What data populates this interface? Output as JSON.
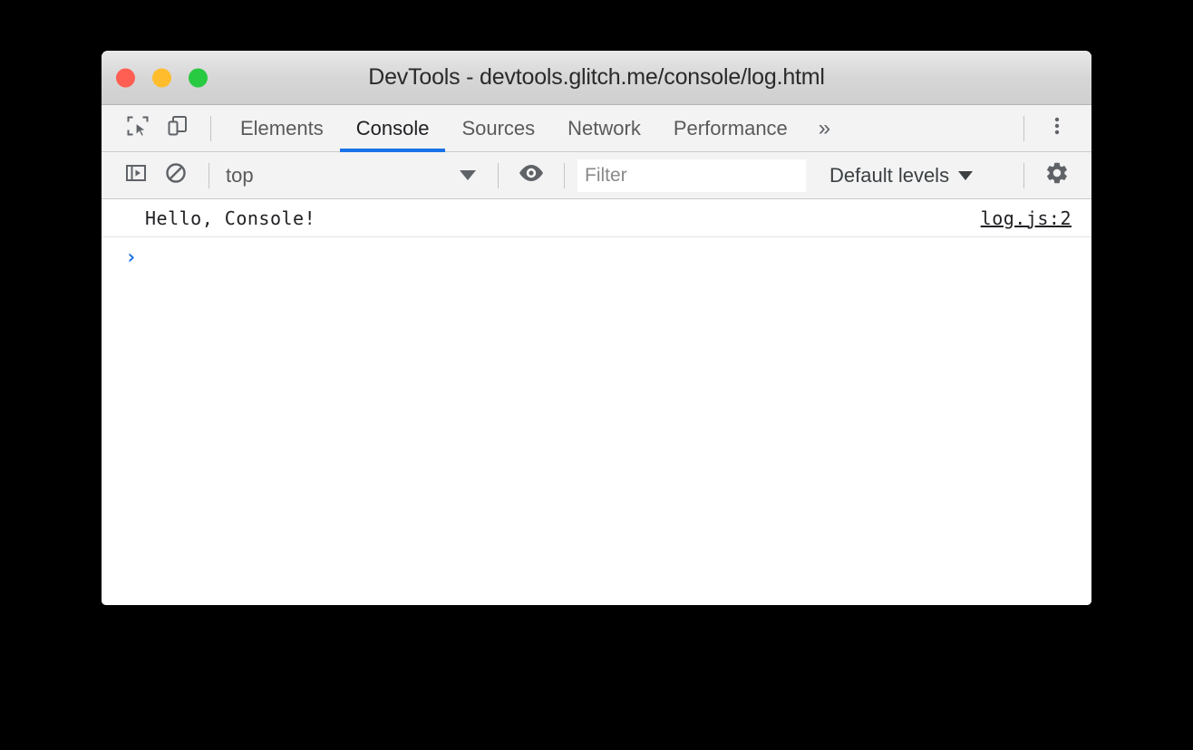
{
  "window": {
    "title": "DevTools - devtools.glitch.me/console/log.html",
    "traffic_lights": [
      {
        "name": "close",
        "color": "#ff5f52"
      },
      {
        "name": "minimize",
        "color": "#ffbd2e"
      },
      {
        "name": "zoom",
        "color": "#28ca42"
      }
    ]
  },
  "tab_bar": {
    "inspect_icon": "inspect-element-icon",
    "device_toolbar_icon": "device-toolbar-icon",
    "tabs": [
      {
        "label": "Elements",
        "active": false
      },
      {
        "label": "Console",
        "active": true
      },
      {
        "label": "Sources",
        "active": false
      },
      {
        "label": "Network",
        "active": false
      },
      {
        "label": "Performance",
        "active": false
      }
    ],
    "more_tabs_label": "»",
    "main_menu_icon": "kebab-menu-icon",
    "active_tab_color": "#1a73e8"
  },
  "console_toolbar": {
    "sidebar_toggle_icon": "show-console-sidebar-icon",
    "clear_console_icon": "clear-console-icon",
    "context": {
      "selected": "top",
      "caret": "chevron-down-icon"
    },
    "live_expression_icon": "eye-icon",
    "filter": {
      "placeholder": "Filter",
      "value": ""
    },
    "levels": {
      "selected": "Default levels",
      "caret": "chevron-down-icon"
    },
    "settings_icon": "gear-icon"
  },
  "console_body": {
    "messages": [
      {
        "text": "Hello, Console!",
        "source": "log.js:2"
      }
    ],
    "prompt": {
      "chevron": "›",
      "value": "",
      "color": "#1a73e8"
    }
  }
}
